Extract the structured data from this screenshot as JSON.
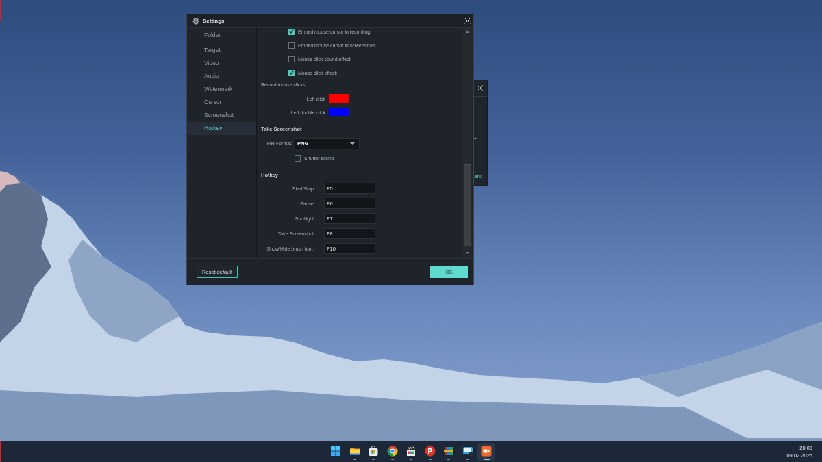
{
  "settings_dialog": {
    "title": "Settings",
    "sidebar": {
      "items": [
        {
          "label": "Folder",
          "selected": false
        },
        {
          "label": "Target",
          "selected": false
        },
        {
          "label": "Video",
          "selected": false
        },
        {
          "label": "Audio",
          "selected": false
        },
        {
          "label": "Watermark",
          "selected": false
        },
        {
          "label": "Cursor",
          "selected": false
        },
        {
          "label": "Screenshot",
          "selected": false
        },
        {
          "label": "Hotkey",
          "selected": true
        }
      ]
    },
    "cursor_options": [
      {
        "label": "Embed mouse cursor in recording.",
        "checked": true
      },
      {
        "label": "Embed mouse cursor in screenshots.",
        "checked": false
      },
      {
        "label": "Mouse click sound effect.",
        "checked": false
      },
      {
        "label": "Mouse click effect:",
        "checked": true
      }
    ],
    "record_mouse_clicks": {
      "label": "Record mouse clicks",
      "colors": [
        {
          "label": "Left click",
          "color": "#ff0000"
        },
        {
          "label": "Left double click",
          "color": "#0000ff"
        }
      ]
    },
    "take_screenshot": {
      "heading": "Take Screenshot",
      "file_format": {
        "label": "File Format:",
        "value": "PNG"
      },
      "shutter_sound": {
        "label": "Shutter sound",
        "checked": false
      }
    },
    "hotkey": {
      "heading": "Hotkey",
      "rows": [
        {
          "label": "Start/Stop",
          "value": "F5"
        },
        {
          "label": "Pause",
          "value": "F6"
        },
        {
          "label": "Spotlight",
          "value": "F7"
        },
        {
          "label": "Take Screenshot",
          "value": "F8"
        },
        {
          "label": "Show/Hide brush tool:",
          "value": "F10"
        }
      ]
    },
    "buttons": {
      "reset": "Reset default",
      "ok": "OK"
    }
  },
  "background_window": {
    "label": "ark"
  },
  "taskbar": {
    "apps": [
      {
        "kind": "start",
        "running": false,
        "selected": false
      },
      {
        "kind": "folder",
        "running": true,
        "selected": false
      },
      {
        "kind": "store",
        "running": true,
        "selected": false
      },
      {
        "kind": "browser",
        "running": true,
        "selected": false
      },
      {
        "kind": "clapper",
        "running": true,
        "selected": false
      },
      {
        "kind": "letter",
        "glyph": "P",
        "running": true,
        "selected": false
      },
      {
        "kind": "books",
        "running": true,
        "selected": false
      },
      {
        "kind": "screen",
        "running": true,
        "selected": false
      },
      {
        "kind": "camera",
        "running": true,
        "selected": true
      }
    ],
    "clock": {
      "time": "20:08",
      "date": "09.02.2025"
    }
  }
}
